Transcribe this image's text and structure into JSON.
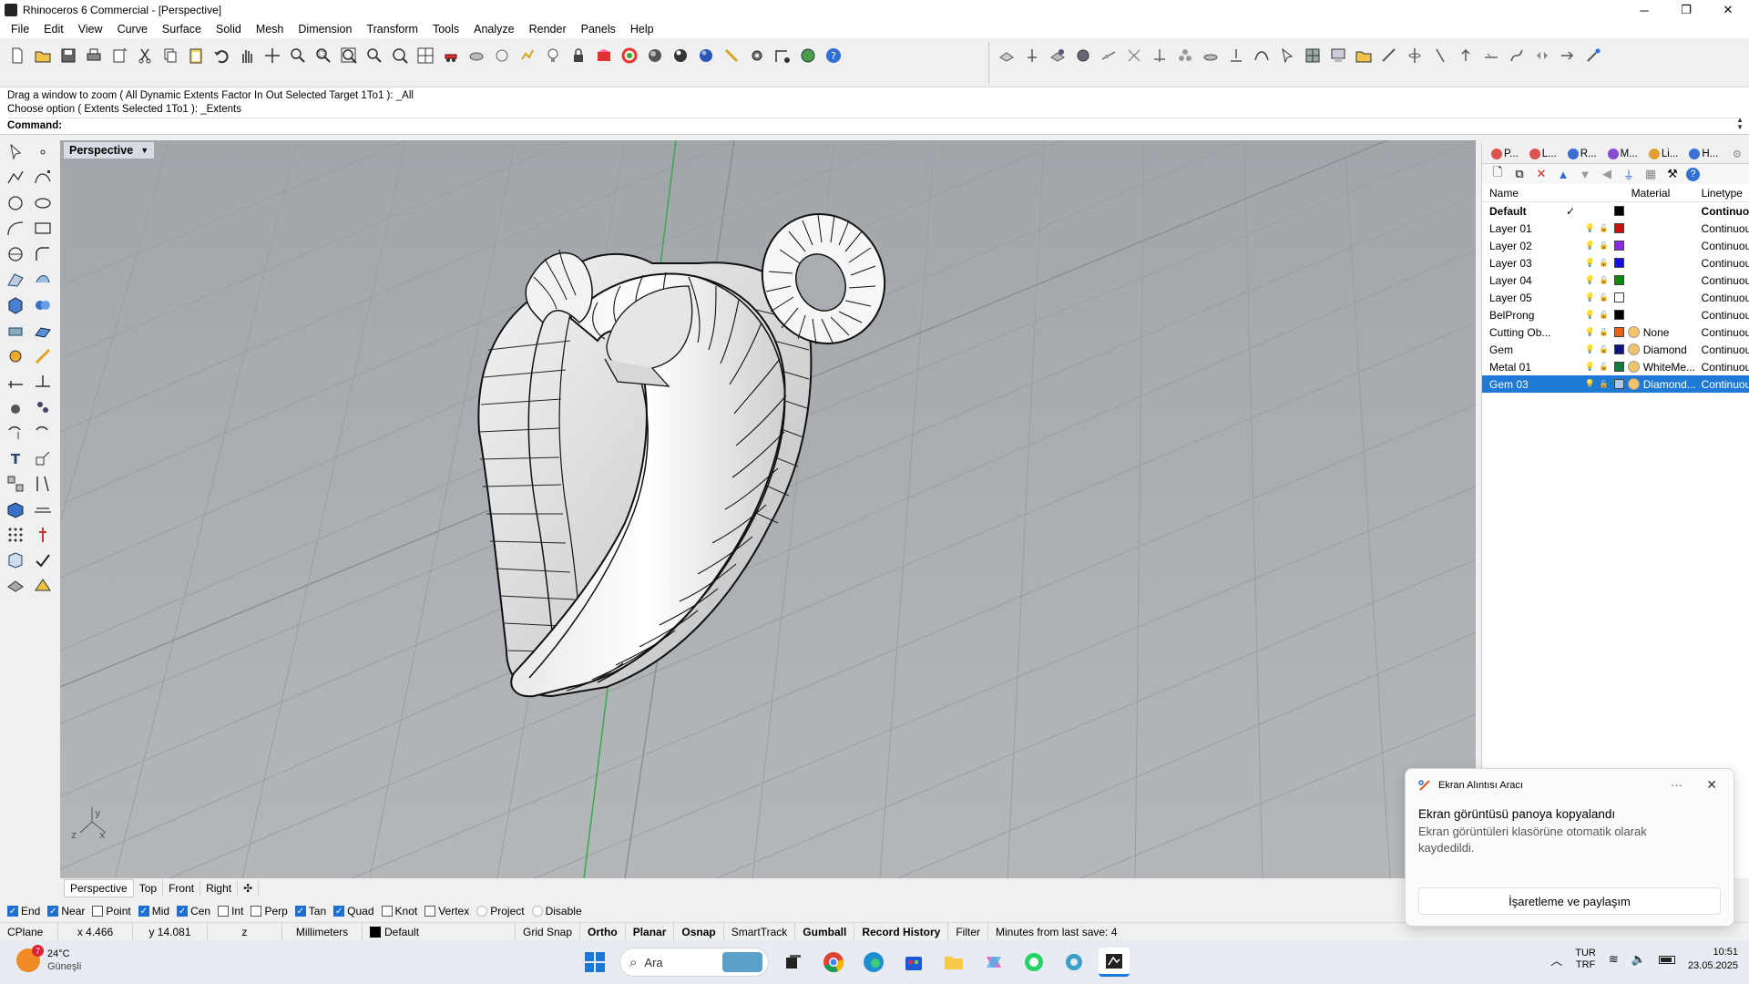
{
  "window": {
    "title": "Rhinoceros 6 Commercial - [Perspective]",
    "minimize": "─",
    "maximize": "❐",
    "close": "✕"
  },
  "menu": [
    "File",
    "Edit",
    "View",
    "Curve",
    "Surface",
    "Solid",
    "Mesh",
    "Dimension",
    "Transform",
    "Tools",
    "Analyze",
    "Render",
    "Panels",
    "Help"
  ],
  "command": {
    "history1": "Drag a window to zoom ( All  Dynamic  Extents  Factor  In  Out  Selected  Target  1To1 ): _All",
    "history2": "Choose option ( Extents  Selected  1To1 ): _Extents",
    "prompt": "Command:",
    "value": ""
  },
  "viewport": {
    "name": "Perspective",
    "axis_x": "x",
    "axis_y": "y",
    "axis_z": "z"
  },
  "viewport_tabs": [
    "Perspective",
    "Top",
    "Front",
    "Right",
    "✣"
  ],
  "panel": {
    "tabs": [
      "P...",
      "L...",
      "R...",
      "M...",
      "Li...",
      "H..."
    ],
    "tab_colors": [
      "#d9534f",
      "#d9534f",
      "#3b6fd6",
      "#8a4ad6",
      "#e0a030",
      "#3b6fd6"
    ],
    "toolbar": [
      "🗋",
      "⧉",
      "✕",
      "▲",
      "▼",
      "◀",
      "⏚",
      "▦",
      "⚒",
      "?"
    ],
    "columns": {
      "name": "Name",
      "material": "Material",
      "linetype": "Linetype"
    },
    "layers": [
      {
        "name": "Default",
        "current": "✓",
        "color": "#000000",
        "material": "",
        "linetype": "Continuou",
        "bold": true,
        "icons": false,
        "selected": false,
        "mat_color": ""
      },
      {
        "name": "Layer 01",
        "current": "",
        "color": "#cc1111",
        "material": "",
        "linetype": "Continuou",
        "bold": false,
        "icons": true,
        "selected": false,
        "mat_color": ""
      },
      {
        "name": "Layer 02",
        "current": "",
        "color": "#8a2be2",
        "material": "",
        "linetype": "Continuou",
        "bold": false,
        "icons": true,
        "selected": false,
        "mat_color": ""
      },
      {
        "name": "Layer 03",
        "current": "",
        "color": "#1111dd",
        "material": "",
        "linetype": "Continuou",
        "bold": false,
        "icons": true,
        "selected": false,
        "mat_color": ""
      },
      {
        "name": "Layer 04",
        "current": "",
        "color": "#118811",
        "material": "",
        "linetype": "Continuou",
        "bold": false,
        "icons": true,
        "selected": false,
        "mat_color": ""
      },
      {
        "name": "Layer 05",
        "current": "",
        "color": "#ffffff",
        "material": "",
        "linetype": "Continuou",
        "bold": false,
        "icons": true,
        "selected": false,
        "mat_color": ""
      },
      {
        "name": "BelProng",
        "current": "",
        "color": "#000000",
        "material": "",
        "linetype": "Continuou",
        "bold": false,
        "icons": true,
        "selected": false,
        "mat_color": ""
      },
      {
        "name": "Cutting Ob...",
        "current": "",
        "color": "#e0641e",
        "material": "None",
        "linetype": "Continuou",
        "bold": false,
        "icons": true,
        "selected": false,
        "mat_color": "#f2c46a"
      },
      {
        "name": "Gem",
        "current": "",
        "color": "#101080",
        "material": "Diamond",
        "linetype": "Continuou",
        "bold": false,
        "icons": true,
        "selected": false,
        "mat_color": "#f2c46a"
      },
      {
        "name": "Metal 01",
        "current": "",
        "color": "#137a40",
        "material": "WhiteMe...",
        "linetype": "Continuou",
        "bold": false,
        "icons": true,
        "selected": false,
        "mat_color": "#f2c46a"
      },
      {
        "name": "Gem 03",
        "current": "",
        "color": "#a8c8f0",
        "material": "Diamond...",
        "linetype": "Continuou",
        "bold": false,
        "icons": true,
        "selected": true,
        "mat_color": "#f2c46a"
      }
    ]
  },
  "osnap": [
    {
      "label": "End",
      "on": true
    },
    {
      "label": "Near",
      "on": true
    },
    {
      "label": "Point",
      "on": false
    },
    {
      "label": "Mid",
      "on": true
    },
    {
      "label": "Cen",
      "on": true
    },
    {
      "label": "Int",
      "on": false
    },
    {
      "label": "Perp",
      "on": false
    },
    {
      "label": "Tan",
      "on": true
    },
    {
      "label": "Quad",
      "on": true
    },
    {
      "label": "Knot",
      "on": false
    },
    {
      "label": "Vertex",
      "on": false
    }
  ],
  "osnap_extra": {
    "project": "Project",
    "disable": "Disable"
  },
  "status": {
    "cplane": "CPlane",
    "x": "x 4.466",
    "y": "y 14.081",
    "z": "z",
    "units": "Millimeters",
    "layer": "Default",
    "gridsnap": "Grid Snap",
    "ortho": "Ortho",
    "planar": "Planar",
    "osnap": "Osnap",
    "smarttrack": "SmartTrack",
    "gumball": "Gumball",
    "history": "Record History",
    "filter": "Filter",
    "lastsave": "Minutes from last save: 4"
  },
  "toast": {
    "app": "Ekran Alıntısı Aracı",
    "more": "···",
    "close": "✕",
    "title": "Ekran görüntüsü panoya kopyalandı",
    "body": "Ekran görüntüleri klasörüne otomatik olarak kaydedildi.",
    "action": "İşaretleme ve paylaşım"
  },
  "taskbar": {
    "weather_temp": "24°C",
    "weather_desc": "Güneşli",
    "weather_badge": "7",
    "search_placeholder": "Ara",
    "lang1": "TUR",
    "lang2": "TRF",
    "time": "10:51",
    "date": "23.05.2025"
  }
}
